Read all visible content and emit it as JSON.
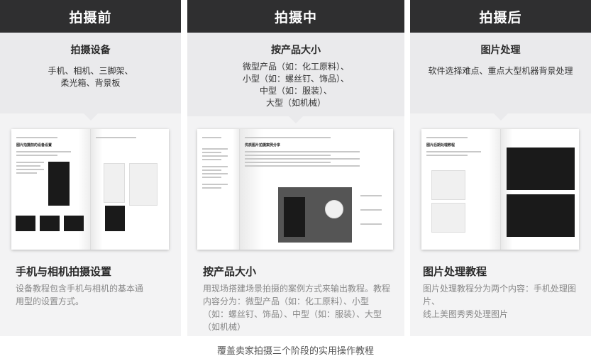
{
  "columns": [
    {
      "stage": "拍摄前",
      "info_title": "拍摄设备",
      "info_body": "手机、相机、三脚架、\n柔光箱、背景板",
      "book_title": "图片拍摄前的设备设置",
      "caption_title": "手机与相机拍摄设置",
      "caption_body": "设备教程包含手机与相机的基本通\n用型的设置方式。"
    },
    {
      "stage": "拍摄中",
      "info_title": "按产品大小",
      "info_body": "微型产品（如：化工原料）、\n小型（如：螺丝钉、饰品）、\n中型（如：服装）、\n大型（如机械）",
      "book_title": "优质图片拍摄案例分享",
      "caption_title": "按产品大小",
      "caption_body": "用现场搭建场景拍摄的案例方式来输出教程。教程\n内容分为：微型产品（如：化工原料）、小型\n（如：螺丝钉、饰品）、中型（如：服装）、大型\n（如机械）"
    },
    {
      "stage": "拍摄后",
      "info_title": "图片处理",
      "info_body": "软件选择难点、重点大型机器背景处理",
      "book_title": "图片后期处理教程",
      "caption_title": "图片处理教程",
      "caption_body": "图片处理教程分为两个内容：手机处理图片、\n线上美图秀秀处理图片"
    }
  ],
  "footer": "覆盖卖家拍摄三个阶段的实用操作教程"
}
